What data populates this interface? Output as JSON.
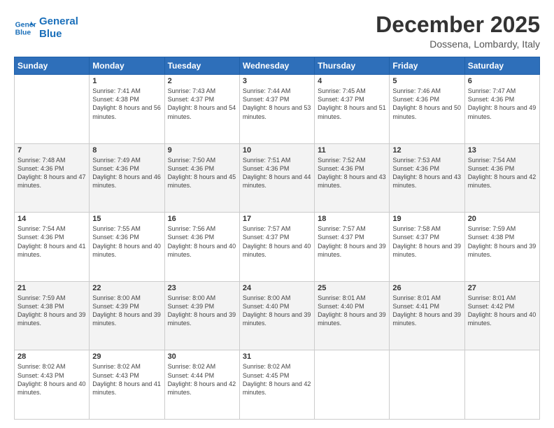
{
  "header": {
    "logo_line1": "General",
    "logo_line2": "Blue",
    "month": "December 2025",
    "location": "Dossena, Lombardy, Italy"
  },
  "days_of_week": [
    "Sunday",
    "Monday",
    "Tuesday",
    "Wednesday",
    "Thursday",
    "Friday",
    "Saturday"
  ],
  "weeks": [
    [
      {
        "day": "",
        "sunrise": "",
        "sunset": "",
        "daylight": ""
      },
      {
        "day": "1",
        "sunrise": "Sunrise: 7:41 AM",
        "sunset": "Sunset: 4:38 PM",
        "daylight": "Daylight: 8 hours and 56 minutes."
      },
      {
        "day": "2",
        "sunrise": "Sunrise: 7:43 AM",
        "sunset": "Sunset: 4:37 PM",
        "daylight": "Daylight: 8 hours and 54 minutes."
      },
      {
        "day": "3",
        "sunrise": "Sunrise: 7:44 AM",
        "sunset": "Sunset: 4:37 PM",
        "daylight": "Daylight: 8 hours and 53 minutes."
      },
      {
        "day": "4",
        "sunrise": "Sunrise: 7:45 AM",
        "sunset": "Sunset: 4:37 PM",
        "daylight": "Daylight: 8 hours and 51 minutes."
      },
      {
        "day": "5",
        "sunrise": "Sunrise: 7:46 AM",
        "sunset": "Sunset: 4:36 PM",
        "daylight": "Daylight: 8 hours and 50 minutes."
      },
      {
        "day": "6",
        "sunrise": "Sunrise: 7:47 AM",
        "sunset": "Sunset: 4:36 PM",
        "daylight": "Daylight: 8 hours and 49 minutes."
      }
    ],
    [
      {
        "day": "7",
        "sunrise": "Sunrise: 7:48 AM",
        "sunset": "Sunset: 4:36 PM",
        "daylight": "Daylight: 8 hours and 47 minutes."
      },
      {
        "day": "8",
        "sunrise": "Sunrise: 7:49 AM",
        "sunset": "Sunset: 4:36 PM",
        "daylight": "Daylight: 8 hours and 46 minutes."
      },
      {
        "day": "9",
        "sunrise": "Sunrise: 7:50 AM",
        "sunset": "Sunset: 4:36 PM",
        "daylight": "Daylight: 8 hours and 45 minutes."
      },
      {
        "day": "10",
        "sunrise": "Sunrise: 7:51 AM",
        "sunset": "Sunset: 4:36 PM",
        "daylight": "Daylight: 8 hours and 44 minutes."
      },
      {
        "day": "11",
        "sunrise": "Sunrise: 7:52 AM",
        "sunset": "Sunset: 4:36 PM",
        "daylight": "Daylight: 8 hours and 43 minutes."
      },
      {
        "day": "12",
        "sunrise": "Sunrise: 7:53 AM",
        "sunset": "Sunset: 4:36 PM",
        "daylight": "Daylight: 8 hours and 43 minutes."
      },
      {
        "day": "13",
        "sunrise": "Sunrise: 7:54 AM",
        "sunset": "Sunset: 4:36 PM",
        "daylight": "Daylight: 8 hours and 42 minutes."
      }
    ],
    [
      {
        "day": "14",
        "sunrise": "Sunrise: 7:54 AM",
        "sunset": "Sunset: 4:36 PM",
        "daylight": "Daylight: 8 hours and 41 minutes."
      },
      {
        "day": "15",
        "sunrise": "Sunrise: 7:55 AM",
        "sunset": "Sunset: 4:36 PM",
        "daylight": "Daylight: 8 hours and 40 minutes."
      },
      {
        "day": "16",
        "sunrise": "Sunrise: 7:56 AM",
        "sunset": "Sunset: 4:36 PM",
        "daylight": "Daylight: 8 hours and 40 minutes."
      },
      {
        "day": "17",
        "sunrise": "Sunrise: 7:57 AM",
        "sunset": "Sunset: 4:37 PM",
        "daylight": "Daylight: 8 hours and 40 minutes."
      },
      {
        "day": "18",
        "sunrise": "Sunrise: 7:57 AM",
        "sunset": "Sunset: 4:37 PM",
        "daylight": "Daylight: 8 hours and 39 minutes."
      },
      {
        "day": "19",
        "sunrise": "Sunrise: 7:58 AM",
        "sunset": "Sunset: 4:37 PM",
        "daylight": "Daylight: 8 hours and 39 minutes."
      },
      {
        "day": "20",
        "sunrise": "Sunrise: 7:59 AM",
        "sunset": "Sunset: 4:38 PM",
        "daylight": "Daylight: 8 hours and 39 minutes."
      }
    ],
    [
      {
        "day": "21",
        "sunrise": "Sunrise: 7:59 AM",
        "sunset": "Sunset: 4:38 PM",
        "daylight": "Daylight: 8 hours and 39 minutes."
      },
      {
        "day": "22",
        "sunrise": "Sunrise: 8:00 AM",
        "sunset": "Sunset: 4:39 PM",
        "daylight": "Daylight: 8 hours and 39 minutes."
      },
      {
        "day": "23",
        "sunrise": "Sunrise: 8:00 AM",
        "sunset": "Sunset: 4:39 PM",
        "daylight": "Daylight: 8 hours and 39 minutes."
      },
      {
        "day": "24",
        "sunrise": "Sunrise: 8:00 AM",
        "sunset": "Sunset: 4:40 PM",
        "daylight": "Daylight: 8 hours and 39 minutes."
      },
      {
        "day": "25",
        "sunrise": "Sunrise: 8:01 AM",
        "sunset": "Sunset: 4:40 PM",
        "daylight": "Daylight: 8 hours and 39 minutes."
      },
      {
        "day": "26",
        "sunrise": "Sunrise: 8:01 AM",
        "sunset": "Sunset: 4:41 PM",
        "daylight": "Daylight: 8 hours and 39 minutes."
      },
      {
        "day": "27",
        "sunrise": "Sunrise: 8:01 AM",
        "sunset": "Sunset: 4:42 PM",
        "daylight": "Daylight: 8 hours and 40 minutes."
      }
    ],
    [
      {
        "day": "28",
        "sunrise": "Sunrise: 8:02 AM",
        "sunset": "Sunset: 4:43 PM",
        "daylight": "Daylight: 8 hours and 40 minutes."
      },
      {
        "day": "29",
        "sunrise": "Sunrise: 8:02 AM",
        "sunset": "Sunset: 4:43 PM",
        "daylight": "Daylight: 8 hours and 41 minutes."
      },
      {
        "day": "30",
        "sunrise": "Sunrise: 8:02 AM",
        "sunset": "Sunset: 4:44 PM",
        "daylight": "Daylight: 8 hours and 42 minutes."
      },
      {
        "day": "31",
        "sunrise": "Sunrise: 8:02 AM",
        "sunset": "Sunset: 4:45 PM",
        "daylight": "Daylight: 8 hours and 42 minutes."
      },
      {
        "day": "",
        "sunrise": "",
        "sunset": "",
        "daylight": ""
      },
      {
        "day": "",
        "sunrise": "",
        "sunset": "",
        "daylight": ""
      },
      {
        "day": "",
        "sunrise": "",
        "sunset": "",
        "daylight": ""
      }
    ]
  ]
}
